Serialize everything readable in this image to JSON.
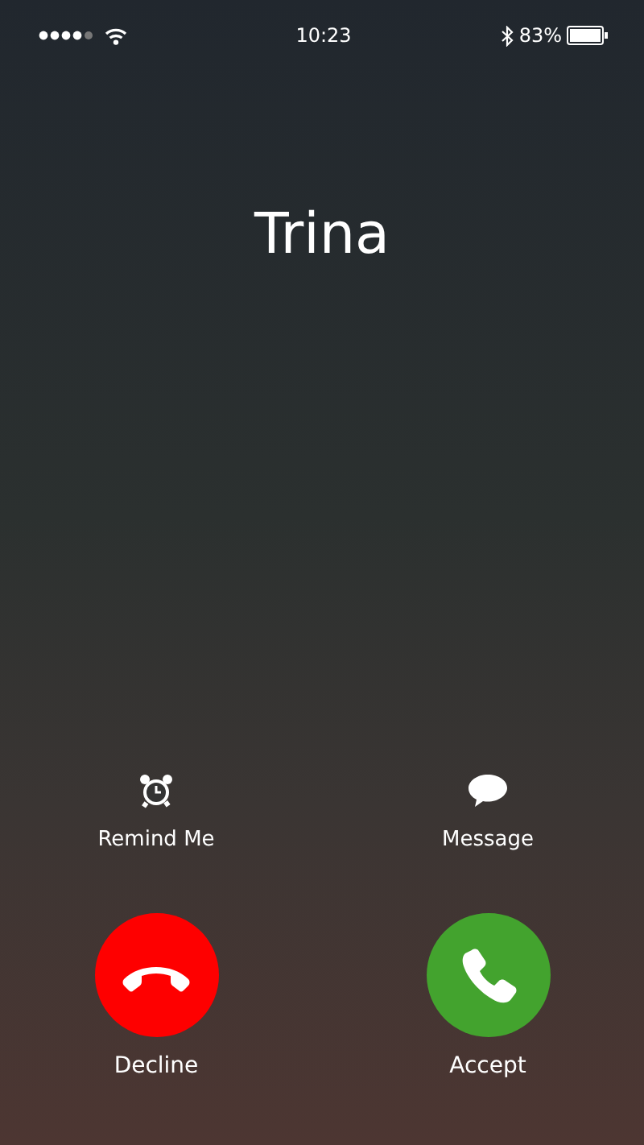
{
  "status_bar": {
    "time": "10:23",
    "battery": "83%"
  },
  "caller": {
    "name": "Trina"
  },
  "options": [
    {
      "kind": "alarm",
      "label": "Remind Me"
    },
    {
      "kind": "message",
      "label": "Message"
    }
  ],
  "call_buttons": [
    {
      "kind": "decline",
      "label": "Decline"
    },
    {
      "kind": "accept",
      "label": "Accept"
    }
  ]
}
